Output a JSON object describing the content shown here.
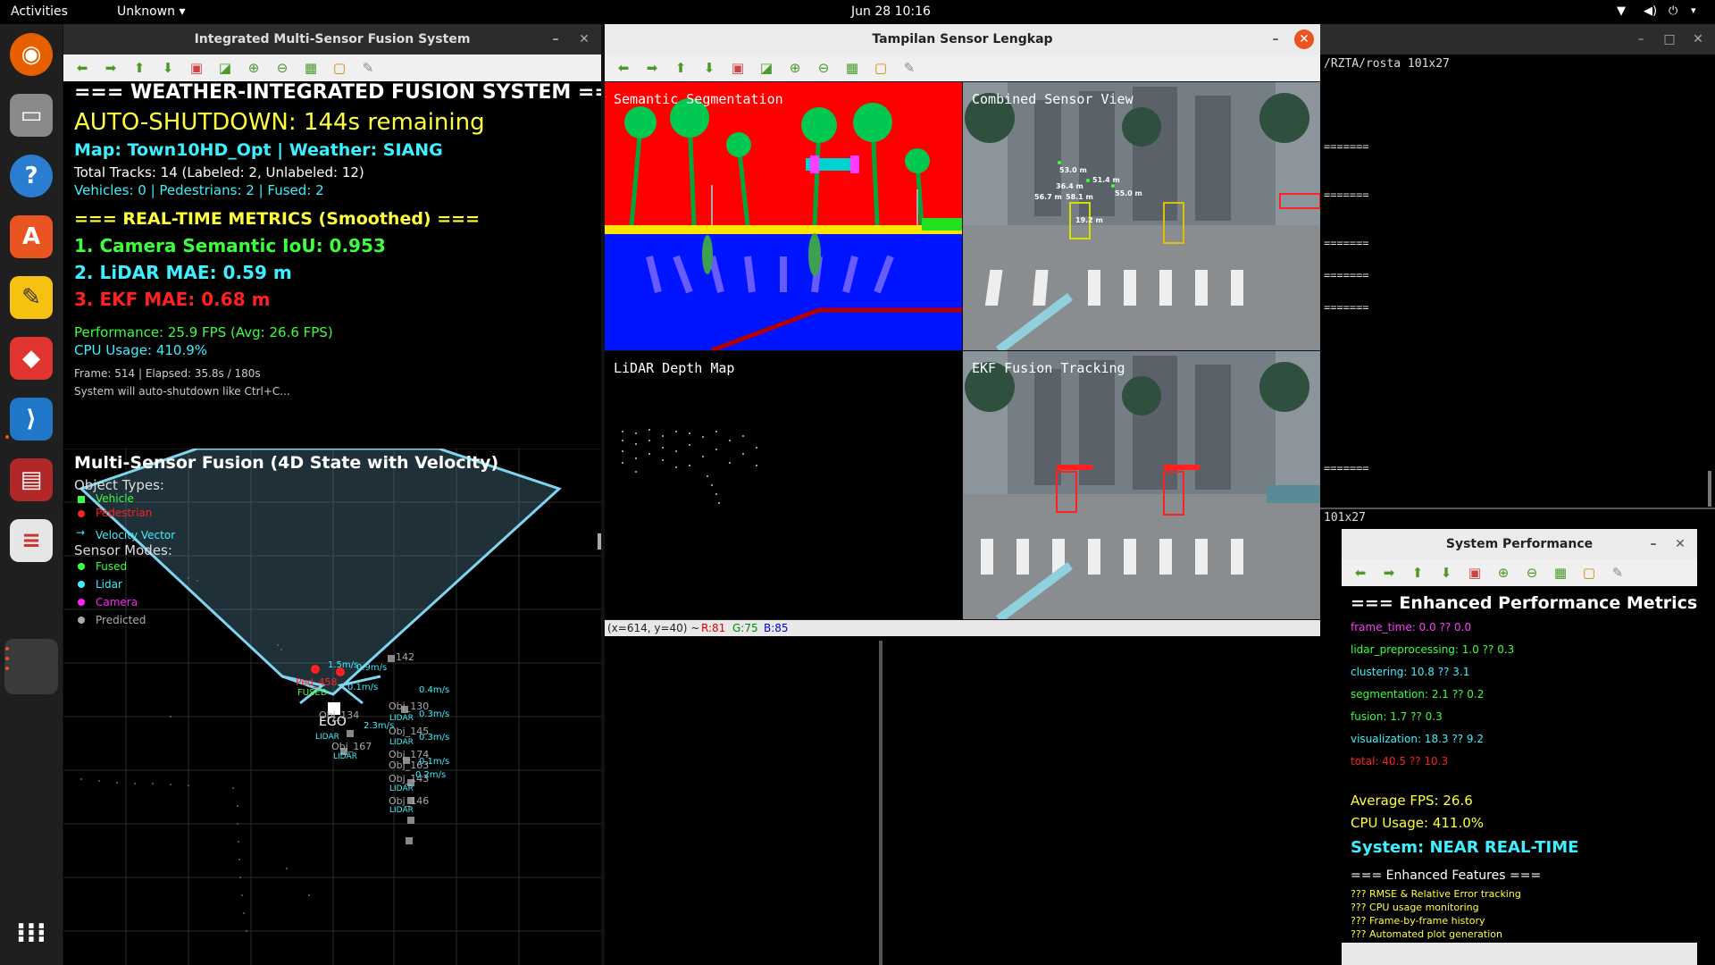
{
  "topbar": {
    "activities": "Activities",
    "app_menu": "Unknown",
    "clock": "Jun 28  10:16"
  },
  "win1": {
    "title": "Integrated Multi-Sensor Fusion System",
    "header": "=== WEATHER-INTEGRATED FUSION SYSTEM ===",
    "shutdown": "AUTO-SHUTDOWN: 144s remaining",
    "map": "Map: Town10HD_Opt | Weather: SIANG",
    "tracks": "Total Tracks: 14 (Labeled: 2, Unlabeled: 12)",
    "counts": "Vehicles: 0 | Pedestrians: 2 | Fused: 2",
    "metrics_header": "=== REAL-TIME METRICS (Smoothed) ===",
    "metric1": "1. Camera Semantic IoU: 0.953",
    "metric2": "2. LiDAR MAE: 0.59 m",
    "metric3": "3. EKF MAE: 0.68 m",
    "performance": "Performance: 25.9 FPS (Avg: 26.6 FPS)",
    "cpu": "CPU Usage: 410.9%",
    "frame": "Frame: 514 | Elapsed: 35.8s / 180s",
    "note": "System will auto-shutdown like Ctrl+C...",
    "fusion_title": "Multi-Sensor Fusion (4D State with Velocity)",
    "object_types": "Object Types:",
    "legend_vehicle": "Vehicle",
    "legend_pedestrian": "Pedestrian",
    "legend_velocity": "Velocity Vector",
    "sensor_modes": "Sensor Modes:",
    "legend_fused": "Fused",
    "legend_lidar": "Lidar",
    "legend_camera": "Camera",
    "legend_predicted": "Predicted",
    "ego": "EGO",
    "ped_label": "Ped_458",
    "fused_label": "FUSED",
    "obj_labels": [
      "142",
      "Obj_130",
      "Obj_145",
      "Obj_174",
      "Obj_143",
      "Obj_146",
      "Obj_134",
      "Obj_167",
      "Obj_163"
    ],
    "lidar_tag": "LIDAR",
    "vel_labels": [
      "1.5m/s",
      "0.9m/s",
      "0.4m/s",
      "0.3m/s",
      "2.3m/s",
      "0.3m/s",
      "0.1m/s",
      "0.2m/s",
      "0.1m/s"
    ]
  },
  "win2": {
    "title": "Tampilan Sensor Lengkap",
    "panel_seg": "Semantic Segmentation",
    "panel_combined": "Combined Sensor View",
    "panel_depth": "LiDAR Depth Map",
    "panel_ekf": "EKF Fusion Tracking",
    "status_coords": "(x=614, y=40) ~",
    "status_r": "R:81",
    "status_g": "G:75",
    "status_b": "B:85",
    "dist_labels": [
      "53.0 m",
      "36.4 m",
      "56.7 m",
      "58.1 m",
      "51.4 m",
      "55.0 m",
      "19.2 m"
    ]
  },
  "terminal": {
    "title": "/RZTA/rosta 101x27",
    "lines": [
      "=======",
      "=======",
      "=======",
      "=======",
      "=======",
      "======="
    ],
    "size2": "101x27"
  },
  "win3": {
    "title": "System Performance",
    "header": "=== Enhanced Performance Metrics (m",
    "frame_time": "frame_time: 0.0 ?? 0.0",
    "lidar_pre": "lidar_preprocessing: 1.0 ?? 0.3",
    "clustering": "clustering: 10.8 ?? 3.1",
    "segmentation": "segmentation: 2.1 ?? 0.2",
    "fusion": "fusion: 1.7 ?? 0.3",
    "visualization": "visualization: 18.3 ?? 9.2",
    "total": "total: 40.5 ?? 10.3",
    "avg_fps": "Average FPS: 26.6",
    "cpu": "CPU Usage: 411.0%",
    "system": "System: NEAR REAL-TIME",
    "features_header": "=== Enhanced Features ===",
    "feat1": "??? RMSE & Relative Error tracking",
    "feat2": "??? CPU usage monitoring",
    "feat3": "??? Frame-by-frame history",
    "feat4": "??? Automated plot generation"
  }
}
